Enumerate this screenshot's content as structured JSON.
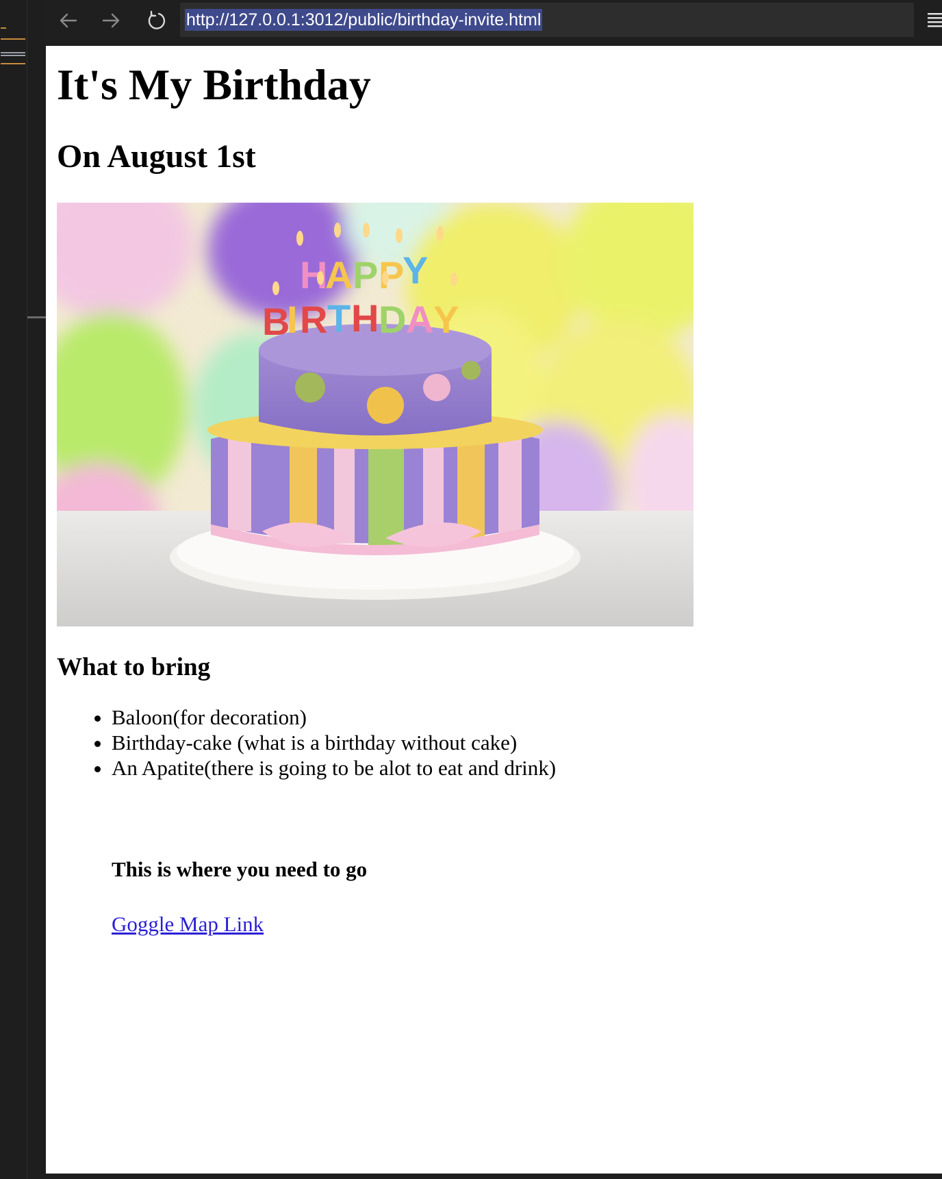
{
  "browser": {
    "url": "http://127.0.0.1:3012/public/birthday-invite.html",
    "back_icon": "arrow-left-icon",
    "forward_icon": "arrow-right-icon",
    "reload_icon": "reload-icon",
    "menu_icon": "hamburger-menu-icon"
  },
  "page": {
    "title": "It's My Birthday",
    "subtitle": "On August 1st",
    "image": {
      "caption_letters_top": "HAPPY",
      "caption_letters_bottom": "BIRTHDAY"
    },
    "bring_heading": "What to bring",
    "bring_items": [
      "Baloon(for decoration)",
      "Birthday-cake (what is a birthday without cake)",
      "An Apatite(there is going to be alot to eat and drink)"
    ],
    "where_heading": "This is where you need to go",
    "map_link_label": "Goggle Map Link"
  },
  "colors": {
    "toolbar_bg": "#1f1f1f",
    "url_bar_bg": "#2d2d2d",
    "url_selection": "#3f4a8c",
    "link": "#2a1fd6"
  }
}
